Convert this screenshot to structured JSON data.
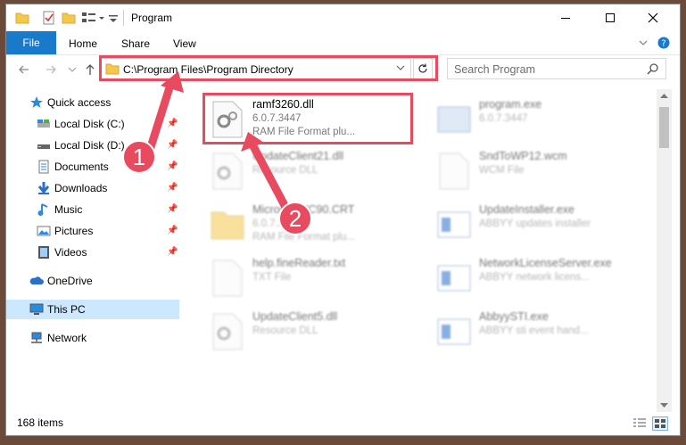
{
  "window": {
    "title": "Program"
  },
  "ribbon": {
    "tabs": [
      "File",
      "Home",
      "Share",
      "View"
    ]
  },
  "address": {
    "path": "C:\\Program Files\\Program Directory"
  },
  "search": {
    "placeholder": "Search Program"
  },
  "sidebar": {
    "items": [
      {
        "label": "Quick access",
        "icon": "star-icon"
      },
      {
        "label": "Local Disk (C:)",
        "icon": "drive-icon"
      },
      {
        "label": "Local Disk (D:)",
        "icon": "drive-icon"
      },
      {
        "label": "Documents",
        "icon": "documents-icon"
      },
      {
        "label": "Downloads",
        "icon": "download-icon"
      },
      {
        "label": "Music",
        "icon": "music-icon"
      },
      {
        "label": "Pictures",
        "icon": "pictures-icon"
      },
      {
        "label": "Videos",
        "icon": "videos-icon"
      },
      {
        "label": "OneDrive",
        "icon": "cloud-icon"
      },
      {
        "label": "This PC",
        "icon": "computer-icon"
      },
      {
        "label": "Network",
        "icon": "network-icon"
      }
    ]
  },
  "files": [
    {
      "name": "ramf3260.dll",
      "line2": "6.0.7.3447",
      "line3": "RAM File Format plu..."
    },
    {
      "name": "program.exe",
      "line2": "6.0.7.3447",
      "line3": ""
    },
    {
      "name": "UpdateClient21.dll",
      "line2": "Resource DLL",
      "line3": ""
    },
    {
      "name": "SndToWP12.wcm",
      "line2": "WCM File",
      "line3": ""
    },
    {
      "name": "Microsoft.VC90.CRT",
      "line2": "6.0.7.3447",
      "line3": "RAM File Format plu..."
    },
    {
      "name": "UpdateInstaller.exe",
      "line2": "ABBYY updates installer",
      "line3": ""
    },
    {
      "name": "help.fineReader.txt",
      "line2": "TXT File",
      "line3": ""
    },
    {
      "name": "NetworkLicenseServer.exe",
      "line2": "ABBYY network licens...",
      "line3": ""
    },
    {
      "name": "UpdateClient5.dll",
      "line2": "Resource DLL",
      "line3": ""
    },
    {
      "name": "AbbyySTI.exe",
      "line2": "ABBYY sti event hand...",
      "line3": ""
    }
  ],
  "status": {
    "count": "168 items"
  },
  "annotations": {
    "badge1": "1",
    "badge2": "2"
  },
  "colors": {
    "accent": "#1979ca",
    "highlight": "#e84a5f",
    "selected": "#cce8ff"
  }
}
